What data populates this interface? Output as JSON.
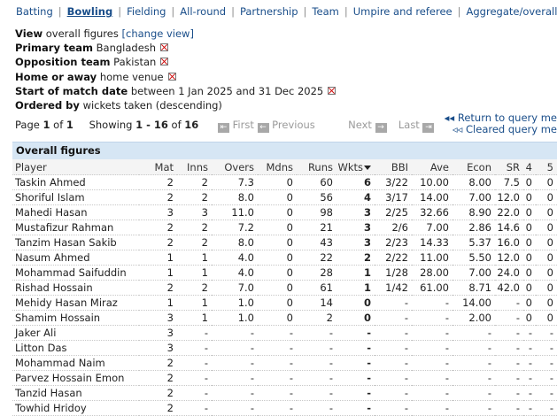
{
  "tabs": [
    {
      "label": "Batting",
      "active": false
    },
    {
      "label": "Bowling",
      "active": true
    },
    {
      "label": "Fielding",
      "active": false
    },
    {
      "label": "All-round",
      "active": false
    },
    {
      "label": "Partnership",
      "active": false
    },
    {
      "label": "Team",
      "active": false
    },
    {
      "label": "Umpire and referee",
      "active": false
    },
    {
      "label": "Aggregate/overall",
      "active": false
    }
  ],
  "view": {
    "label": "View",
    "value": "overall figures",
    "change_link": "[change view]"
  },
  "filters": [
    {
      "label": "Primary team",
      "value": "Bangladesh"
    },
    {
      "label": "Opposition team",
      "value": "Pakistan"
    },
    {
      "label": "Home or away",
      "value": "home venue"
    },
    {
      "label": "Start of match date",
      "value": "between 1 Jan 2025 and 31 Dec 2025"
    }
  ],
  "ordered_by": {
    "label": "Ordered by",
    "value": "wickets taken (descending)"
  },
  "paging": {
    "page_word": "Page",
    "page": "1",
    "of_word": "of",
    "pages": "1",
    "showing_word": "Showing",
    "range": "1 - 16",
    "total": "16",
    "first": "First",
    "previous": "Previous",
    "next": "Next",
    "last": "Last"
  },
  "query_links": {
    "return": "Return to query me",
    "cleared": "Cleared query me"
  },
  "table": {
    "caption": "Overall figures",
    "columns": [
      "Player",
      "Mat",
      "Inns",
      "Overs",
      "Mdns",
      "Runs",
      "Wkts",
      "BBI",
      "Ave",
      "Econ",
      "SR",
      "4",
      "5"
    ],
    "rows": [
      [
        "Taskin Ahmed",
        "2",
        "2",
        "7.3",
        "0",
        "60",
        "6",
        "3/22",
        "10.00",
        "8.00",
        "7.5",
        "0",
        "0"
      ],
      [
        "Shoriful Islam",
        "2",
        "2",
        "8.0",
        "0",
        "56",
        "4",
        "3/17",
        "14.00",
        "7.00",
        "12.0",
        "0",
        "0"
      ],
      [
        "Mahedi Hasan",
        "3",
        "3",
        "11.0",
        "0",
        "98",
        "3",
        "2/25",
        "32.66",
        "8.90",
        "22.0",
        "0",
        "0"
      ],
      [
        "Mustafizur Rahman",
        "2",
        "2",
        "7.2",
        "0",
        "21",
        "3",
        "2/6",
        "7.00",
        "2.86",
        "14.6",
        "0",
        "0"
      ],
      [
        "Tanzim Hasan Sakib",
        "2",
        "2",
        "8.0",
        "0",
        "43",
        "3",
        "2/23",
        "14.33",
        "5.37",
        "16.0",
        "0",
        "0"
      ],
      [
        "Nasum Ahmed",
        "1",
        "1",
        "4.0",
        "0",
        "22",
        "2",
        "2/22",
        "11.00",
        "5.50",
        "12.0",
        "0",
        "0"
      ],
      [
        "Mohammad Saifuddin",
        "1",
        "1",
        "4.0",
        "0",
        "28",
        "1",
        "1/28",
        "28.00",
        "7.00",
        "24.0",
        "0",
        "0"
      ],
      [
        "Rishad Hossain",
        "2",
        "2",
        "7.0",
        "0",
        "61",
        "1",
        "1/42",
        "61.00",
        "8.71",
        "42.0",
        "0",
        "0"
      ],
      [
        "Mehidy Hasan Miraz",
        "1",
        "1",
        "1.0",
        "0",
        "14",
        "0",
        "-",
        "-",
        "14.00",
        "-",
        "0",
        "0"
      ],
      [
        "Shamim Hossain",
        "3",
        "1",
        "1.0",
        "0",
        "2",
        "0",
        "-",
        "-",
        "2.00",
        "-",
        "0",
        "0"
      ],
      [
        "Jaker Ali",
        "3",
        "-",
        "-",
        "-",
        "-",
        "-",
        "-",
        "-",
        "-",
        "-",
        "-",
        "-"
      ],
      [
        "Litton Das",
        "3",
        "-",
        "-",
        "-",
        "-",
        "-",
        "-",
        "-",
        "-",
        "-",
        "-",
        "-"
      ],
      [
        "Mohammad Naim",
        "2",
        "-",
        "-",
        "-",
        "-",
        "-",
        "-",
        "-",
        "-",
        "-",
        "-",
        "-"
      ],
      [
        "Parvez Hossain Emon",
        "2",
        "-",
        "-",
        "-",
        "-",
        "-",
        "-",
        "-",
        "-",
        "-",
        "-",
        "-"
      ],
      [
        "Tanzid Hasan",
        "2",
        "-",
        "-",
        "-",
        "-",
        "-",
        "-",
        "-",
        "-",
        "-",
        "-",
        "-"
      ],
      [
        "Towhid Hridoy",
        "2",
        "-",
        "-",
        "-",
        "-",
        "-",
        "-",
        "-",
        "-",
        "-",
        "-",
        "-"
      ]
    ]
  },
  "colors": {
    "link": "#1a4e8a",
    "caption_bg": "#d6e6f4",
    "remove_x": "#cc0000"
  }
}
